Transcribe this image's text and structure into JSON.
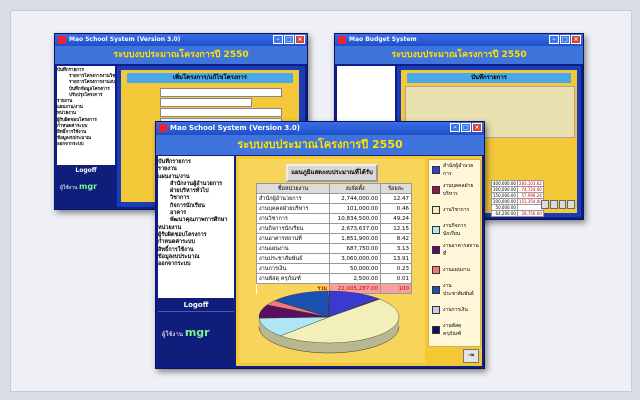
{
  "left_window": {
    "title": "Mao School System (Version 3.0)",
    "banner": "ระบบงบประมาณโครงการปี 2550",
    "menu": [
      "บันทึกรายการ",
      "รายการโครงการงานวิชาการ",
      "รายการโครงการงานงบประมาณ",
      "บันทึกข้อมูลโครงการ",
      "ปรับปรุงโครงการ",
      "รายงาน",
      "แผนงาน/งาน",
      "หน่วยงาน",
      "ผู้รับผิดชอบโครงการ",
      "กำหนดค่าระบบ",
      "สิทธิ์การใช้งาน",
      "ข้อมูลงบประมาณ",
      "ออกจากระบบ"
    ],
    "section_title": "เพิ่มโครงการ/แก้ไขโครงการ",
    "logoff": {
      "label": "Logoff",
      "user_label": "ผู้ใช้งาน",
      "user": "mgr"
    }
  },
  "right_window": {
    "title": "Mao Budget System",
    "banner": "ระบบงบประมาณโครงการปี 2550",
    "section_title": "บันทึกรายการ",
    "table_rows": [
      {
        "v1": "400,000.00",
        "v2": "283,103.62"
      },
      {
        "v1": "100,000.00",
        "v2": "74,724.00"
      },
      {
        "v1": "150,000.00",
        "v2": "57,996.24"
      },
      {
        "v1": "200,000.00",
        "v2": "151,354.00"
      },
      {
        "v1": "50,000.00",
        "v2": ""
      },
      {
        "v1": "64,200.00",
        "v2": "28,750.00"
      }
    ]
  },
  "main_window": {
    "title": "Mao School System (Version 3.0)",
    "banner": "ระบบงบประมาณโครงการปี 2550",
    "menu": [
      {
        "label": "บันทึกรายการ",
        "sub": false
      },
      {
        "label": "รายงาน",
        "sub": false
      },
      {
        "label": "แผนงาน/งาน",
        "sub": false
      },
      {
        "label": "สำนักงานผู้อำนวยการ",
        "sub": true
      },
      {
        "label": "ฝ่ายบริหารทั่วไป",
        "sub": true
      },
      {
        "label": "วิชาการ",
        "sub": true
      },
      {
        "label": "กิจการนักเรียน",
        "sub": true
      },
      {
        "label": "อาคาร",
        "sub": true
      },
      {
        "label": "พัฒนาคุณภาพการศึกษา",
        "sub": true
      },
      {
        "label": "หน่วยงาน",
        "sub": false
      },
      {
        "label": "ผู้รับผิดชอบโครงการ",
        "sub": false
      },
      {
        "label": "กำหนดค่าระบบ",
        "sub": false
      },
      {
        "label": "สิทธิ์การใช้งาน",
        "sub": false
      },
      {
        "label": "ข้อมูลงบประมาณ",
        "sub": false
      },
      {
        "label": "ออกจากระบบ",
        "sub": false
      }
    ],
    "logoff": {
      "label": "Logoff",
      "user_label": "ผู้ใช้งาน",
      "user": "mgr"
    },
    "report_button": "แผนภูมิแสดงงบประมาณที่ได้รับ",
    "table": {
      "headers": [
        "ชื่อหน่วยงาน",
        "งบจัดตั้ง",
        "ร้อยละ"
      ],
      "rows": [
        {
          "name": "สำนักผู้อำนวยการ",
          "budget": "2,744,000.00",
          "pct": "12.47"
        },
        {
          "name": "งานบุคคลฝ่ายบริหาร",
          "budget": "101,000.00",
          "pct": "0.46"
        },
        {
          "name": "งานวิชาการ",
          "budget": "10,834,500.00",
          "pct": "49.24"
        },
        {
          "name": "งานกิจการนักเรียน",
          "budget": "2,673,637.00",
          "pct": "12.15"
        },
        {
          "name": "งานอาคารสถานที่",
          "budget": "1,851,900.00",
          "pct": "8.42"
        },
        {
          "name": "งานแผนงาน",
          "budget": "687,750.00",
          "pct": "3.13"
        },
        {
          "name": "งานประชาสัมพันธ์",
          "budget": "3,060,000.00",
          "pct": "13.91"
        },
        {
          "name": "งานการเงิน",
          "budget": "50,000.00",
          "pct": "0.23"
        },
        {
          "name": "งานพัสดุ ครุภัณฑ์",
          "budget": "2,500.00",
          "pct": "0.01"
        }
      ],
      "total_label": "รวม",
      "total_budget": "22,005,287.00",
      "total_pct": "100"
    },
    "legend": [
      {
        "label": "สำนักผู้อำนวยการ",
        "color": "#3a3ad0"
      },
      {
        "label": "งานบุคคลฝ่ายบริหาร",
        "color": "#8b1a4a"
      },
      {
        "label": "งานวิชาการ",
        "color": "#f2f0b8"
      },
      {
        "label": "งานกิจการนักเรียน",
        "color": "#aee8f5"
      },
      {
        "label": "งานอาคารสถานที่",
        "color": "#5a1060"
      },
      {
        "label": "งานแผนงาน",
        "color": "#f07a7a"
      },
      {
        "label": "งานประชาสัมพันธ์",
        "color": "#1a50b0"
      },
      {
        "label": "งานการเงิน",
        "color": "#c8c8f0"
      },
      {
        "label": "งานพัสดุ ครุภัณฑ์",
        "color": "#101060"
      }
    ],
    "pie_values": [
      12.47,
      0.46,
      49.24,
      12.15,
      8.42,
      3.13,
      13.91,
      0.23,
      0.01
    ]
  }
}
